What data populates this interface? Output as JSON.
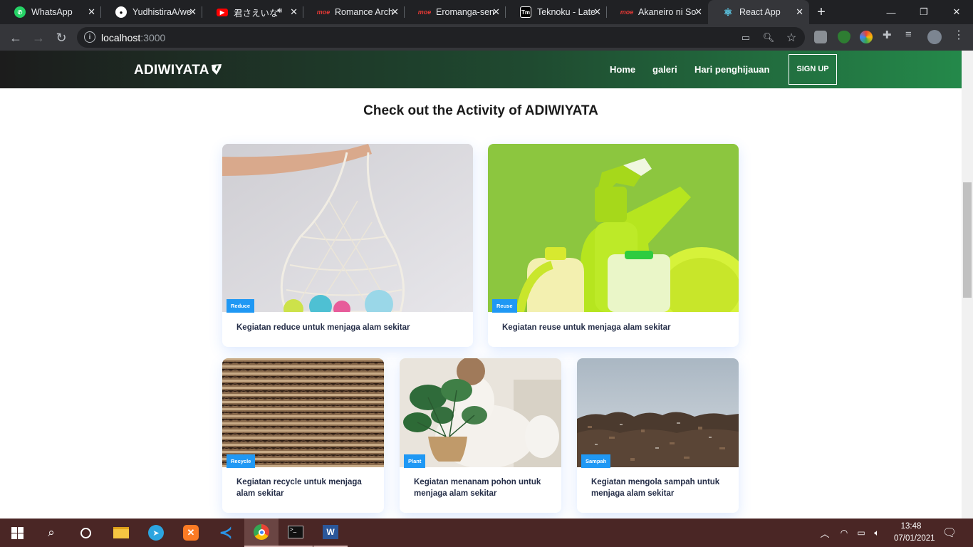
{
  "browser": {
    "tabs": [
      {
        "title": "WhatsApp",
        "favicon": "whatsapp-icon",
        "color": "#25d366"
      },
      {
        "title": "YudhistiraA/web",
        "favicon": "github-icon",
        "color": "#ffffff"
      },
      {
        "title": "君さえいなけれ",
        "favicon": "youtube-icon",
        "color": "#ff0000"
      },
      {
        "title": "Romance Archive",
        "favicon": "moe-icon",
        "color": "#c62828"
      },
      {
        "title": "Eromanga-sensei",
        "favicon": "moe-icon",
        "color": "#c62828"
      },
      {
        "title": "Teknoku - Latest",
        "favicon": "tm-icon",
        "color": "#000000"
      },
      {
        "title": "Akaneiro ni Some",
        "favicon": "moe-icon",
        "color": "#c62828"
      },
      {
        "title": "React App",
        "favicon": "react-icon",
        "color": "#61dafb"
      }
    ],
    "url_host": "localhost",
    "url_port": ":3000"
  },
  "site": {
    "logo": "ADIWIYATA",
    "nav": [
      "Home",
      "galeri",
      "Hari penghijauan"
    ],
    "signup": "SIGN UP",
    "heading": "Check out the Activity of ADIWIYATA"
  },
  "cards": [
    {
      "badge": "Reduce",
      "text": "Kegiatan reduce untuk menjaga alam sekitar"
    },
    {
      "badge": "Reuse",
      "text": "Kegiatan reuse untuk menjaga alam sekitar"
    },
    {
      "badge": "Recycle",
      "text": "Kegiatan recycle untuk menjaga alam sekitar"
    },
    {
      "badge": "Plant",
      "text": "Kegiatan menanam pohon untuk menjaga alam sekitar"
    },
    {
      "badge": "Sampah",
      "text": "Kegiatan mengola sampah untuk menjaga alam sekitar"
    }
  ],
  "taskbar": {
    "time": "13:48",
    "date": "07/01/2021"
  }
}
